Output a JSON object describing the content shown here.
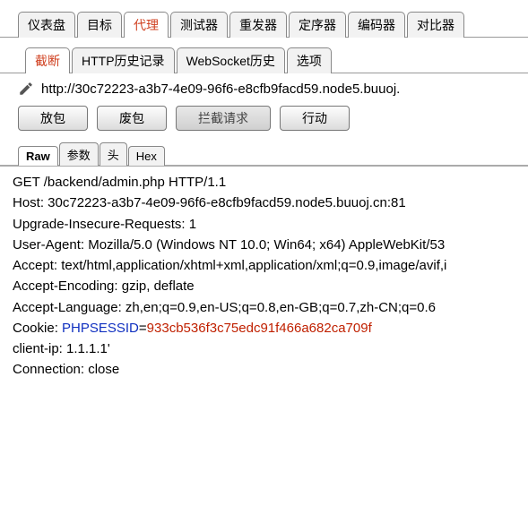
{
  "topTabs": {
    "items": [
      "仪表盘",
      "目标",
      "代理",
      "测试器",
      "重发器",
      "定序器",
      "编码器",
      "对比器"
    ],
    "activeIndex": 2
  },
  "subTabs": {
    "items": [
      "截断",
      "HTTP历史记录",
      "WebSocket历史",
      "选项"
    ],
    "activeIndex": 0
  },
  "url": "http://30c72223-a3b7-4e09-96f6-e8cfb9facd59.node5.buuoj.",
  "buttons": {
    "forward": "放包",
    "drop": "废包",
    "intercept": "拦截请求",
    "action": "行动"
  },
  "viewTabs": {
    "items": [
      "Raw",
      "参数",
      "头",
      "Hex"
    ],
    "activeIndex": 0
  },
  "request": {
    "line0": "GET /backend/admin.php HTTP/1.1",
    "line1": "Host: 30c72223-a3b7-4e09-96f6-e8cfb9facd59.node5.buuoj.cn:81",
    "line2": "Upgrade-Insecure-Requests: 1",
    "line3": "User-Agent: Mozilla/5.0 (Windows NT 10.0; Win64; x64) AppleWebKit/53",
    "line4": "Accept: text/html,application/xhtml+xml,application/xml;q=0.9,image/avif,i",
    "line5": "Accept-Encoding: gzip, deflate",
    "line6": "Accept-Language: zh,en;q=0.9,en-US;q=0.8,en-GB;q=0.7,zh-CN;q=0.6",
    "cookiePrefix": "Cookie: ",
    "cookieKey": "PHPSESSID",
    "cookieEq": "=",
    "cookieVal": "933cb536f3c75edc91f466a682ca709f",
    "line8": "client-ip: 1.1.1.1'",
    "line9": "Connection: close"
  }
}
